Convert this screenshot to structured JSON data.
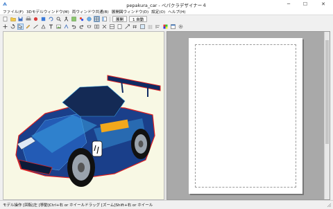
{
  "window": {
    "title": "pepakura_car - ペパクラデザイナー４",
    "minimize_glyph": "─",
    "maximize_glyph": "☐",
    "close_glyph": "✕"
  },
  "menu": [
    "ファイル(F)",
    "3Dモデルウィンドウ(M)",
    "両ウィンドウ共通(B)",
    "展開図ウィンドウ(D)",
    "設定(O)",
    "ヘルプ(H)"
  ],
  "toolbar": {
    "unfold_label": "展開",
    "auto_label": "1 自動"
  },
  "statusbar": {
    "text": "モデル操作 [回転]左 [移動]Ctrl+右 or ホイールドラッグ [ズーム]Shift+右 or ホイール"
  },
  "colors": {
    "model_bg": "#f8f8e4",
    "paper_area_bg": "#a9a9a9",
    "car_body": "#1a3f8a",
    "car_accent": "#3aa0e0",
    "car_edge": "#e02020"
  }
}
